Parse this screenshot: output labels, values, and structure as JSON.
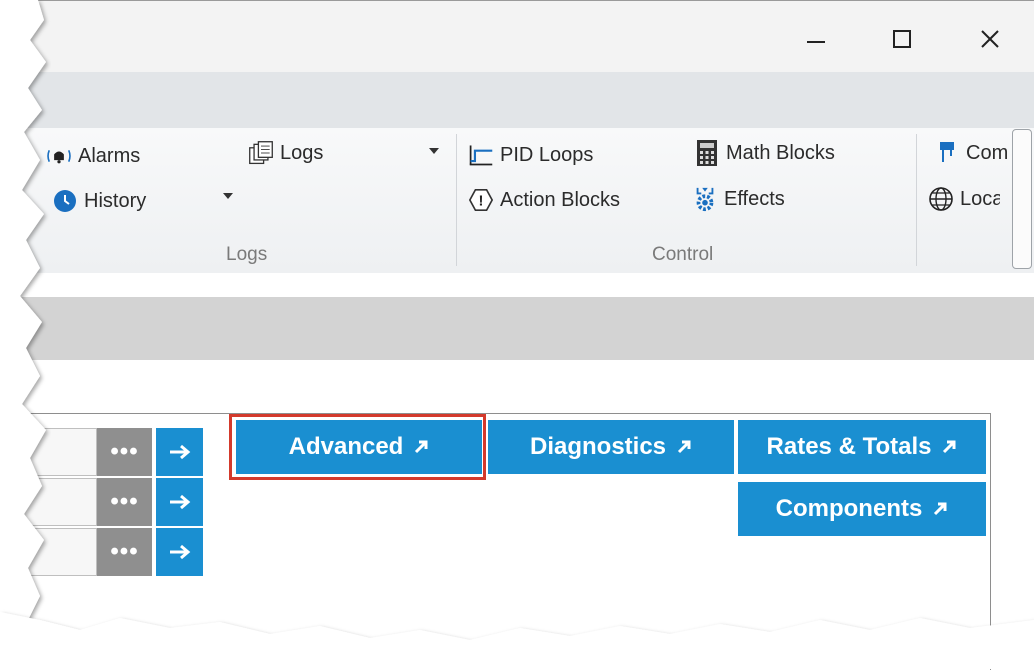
{
  "window": {
    "minimize_icon": "minimize-icon",
    "maximize_icon": "maximize-icon",
    "close_icon": "close-icon"
  },
  "ribbon": {
    "groups": {
      "logs": {
        "label": "Logs",
        "alarms": "Alarms",
        "history": "History",
        "logs": "Logs"
      },
      "control": {
        "label": "Control",
        "pid_loops": "PID Loops",
        "action_blocks": "Action Blocks",
        "math_blocks": "Math Blocks",
        "effects": "Effects"
      },
      "next": {
        "item1": "Com",
        "item2": "Loca"
      }
    }
  },
  "rows": [
    {
      "dots": "•••"
    },
    {
      "dots": "•••"
    },
    {
      "dots": "•••"
    }
  ],
  "nav": {
    "advanced": "Advanced",
    "diagnostics": "Diagnostics",
    "rates_totals": "Rates & Totals",
    "components": "Components"
  },
  "colors": {
    "accent": "#1a8fd1",
    "highlight": "#d33a2c",
    "dots_bg": "#8f8f8f"
  }
}
